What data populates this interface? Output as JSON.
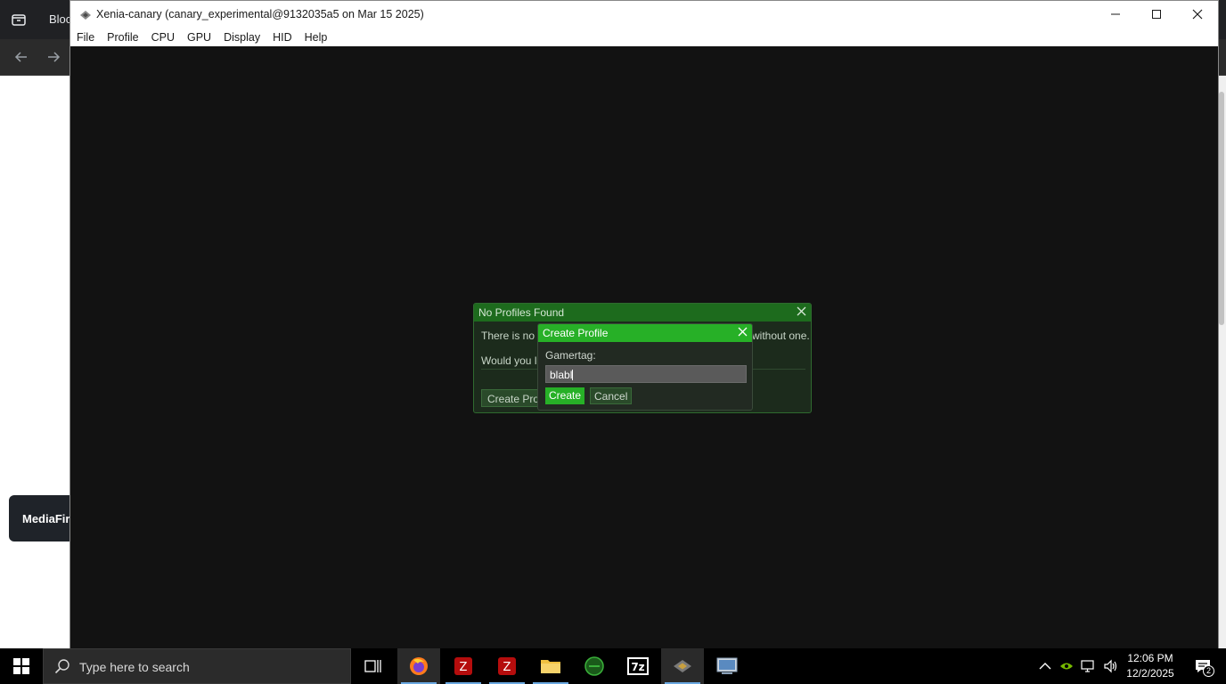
{
  "browser": {
    "tab_title": "Bloc",
    "toast": "MediaFire"
  },
  "xenia": {
    "title": "Xenia-canary (canary_experimental@9132035a5 on Mar 15 2025)",
    "menu": [
      "File",
      "Profile",
      "CPU",
      "GPU",
      "Display",
      "HID",
      "Help"
    ]
  },
  "no_profiles_dialog": {
    "title": "No Profiles Found",
    "line1_left": "There is no p",
    "line1_right": "without one.",
    "line2": "Would you li",
    "button": "Create Profi"
  },
  "create_profile_dialog": {
    "title": "Create Profile",
    "field_label": "Gamertag:",
    "field_value": "blabl",
    "create_label": "Create",
    "cancel_label": "Cancel"
  },
  "taskbar": {
    "search_placeholder": "Type here to search",
    "apps": [
      "task-view",
      "firefox",
      "filezilla",
      "filezilla",
      "file-explorer",
      "xenia-green",
      "7zip",
      "xenia-canary",
      "control-panel"
    ],
    "clock_time": "12:06 PM",
    "clock_date": "12/2/2025",
    "notification_count": "2"
  },
  "colors": {
    "dialog_header": "#1d6b1d",
    "accent_green": "#27b027",
    "window_bg": "#121212"
  }
}
